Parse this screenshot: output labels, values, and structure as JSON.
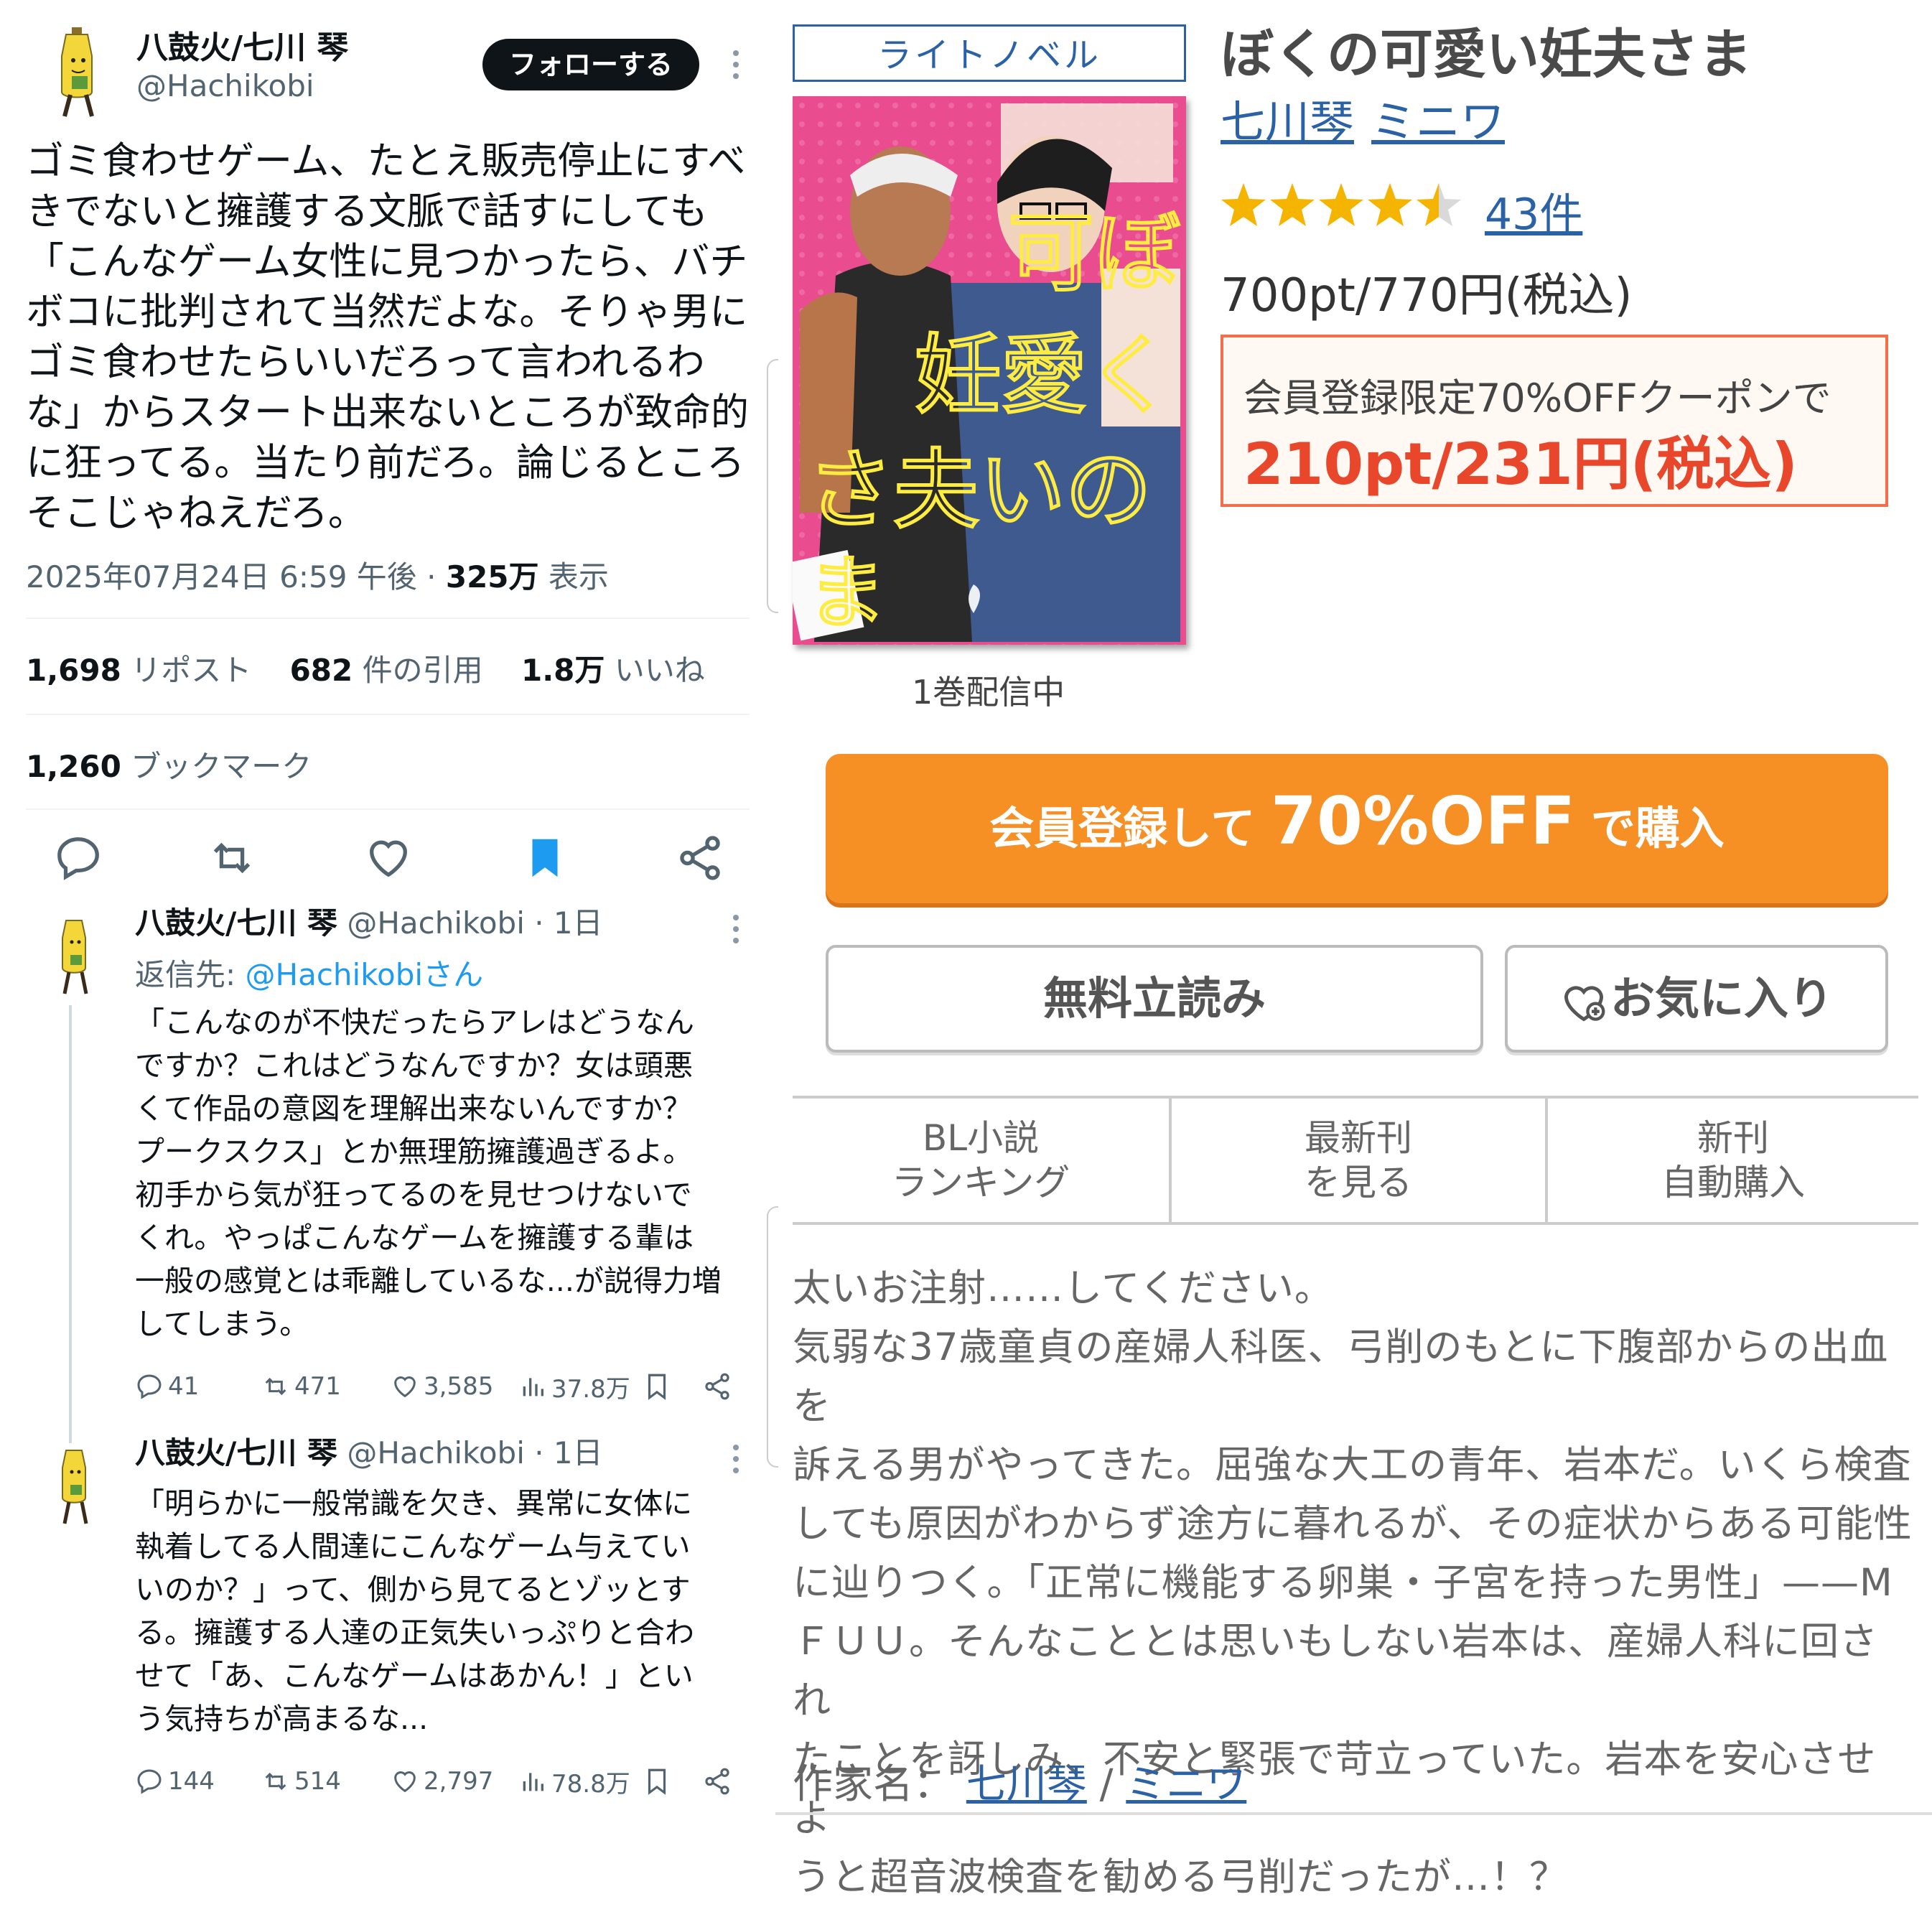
{
  "tweet": {
    "display_name": "八鼓火/七川 琴",
    "handle": "@Hachikobi",
    "follow_label": "フォローする",
    "text": "ゴミ食わせゲーム、たとえ販売停止にすべ\nきでないと擁護する文脈で話すにしても\n「こんなゲーム女性に見つかったら、バチ\nボコに批判されて当然だよな。そりゃ男に\nゴミ食わせたらいいだろって言われるわ\nな」からスタート出来ないところが致命的\nに狂ってる。当たり前だろ。論じるところ\nそこじゃねえだろ。",
    "timestamp": "2025年07月24日 6:59 午後 · ",
    "views_count": "325万",
    "views_label": " 表示",
    "reposts_count": "1,698",
    "reposts_label": " リポスト",
    "quotes_count": "682",
    "quotes_label": " 件の引用",
    "likes_count": "1.8万",
    "likes_label": " いいね",
    "bookmarks_count": "1,260",
    "bookmarks_label": " ブックマーク"
  },
  "replies": [
    {
      "display_name": "八鼓火/七川 琴",
      "handle_time": " @Hachikobi · 1日",
      "reply_to_prefix": "返信先: ",
      "reply_to_handle": "@Hachikobiさん",
      "text": "「こんなのが不快だったらアレはどうなん\nですか？これはどうなんですか？女は頭悪\nくて作品の意図を理解出来ないんですか？\nプークスクス」とか無理筋擁護過ぎるよ。\n初手から気が狂ってるのを見せつけないで\nくれ。やっぱこんなゲームを擁護する輩は\n一般の感覚とは乖離しているな...が説得力増\nしてしまう。",
      "replies": "41",
      "reposts": "471",
      "likes": "3,585",
      "views": "37.8万"
    },
    {
      "display_name": "八鼓火/七川 琴",
      "handle_time": " @Hachikobi · 1日",
      "text": "「明らかに一般常識を欠き、異常に女体に\n執着してる人間達にこんなゲーム与えてい\nいのか？」って、側から見てるとゾッとす\nる。擁護する人達の正気失いっぷりと合わ\nせて「あ、こんなゲームはあかん！」とい\nう気持ちが高まるな...",
      "replies": "144",
      "reposts": "514",
      "likes": "2,797",
      "views": "78.8万"
    }
  ],
  "store": {
    "genre_tag": "ライトノベル",
    "title": "ぼくの可愛い妊夫さま",
    "author1": "七川琴",
    "author2": "ミニワ",
    "rating": 4.5,
    "review_count": "43件",
    "price": "700pt/770円(税込)",
    "coupon_line1": "会員登録限定70%OFFクーポンで",
    "coupon_line2": "210pt/231円(税込)",
    "cover_title": "ぼくの可愛い妊夫さま",
    "volumes": "1巻配信中",
    "buy_small1": "会員登録して ",
    "buy_big": "70%OFF",
    "buy_small2": " で購入",
    "free_read_label": "無料立読み",
    "favorite_label": "お気に入り",
    "tabs": [
      {
        "line1": "BL小説",
        "line2": "ランキング"
      },
      {
        "line1": "最新刊",
        "line2": "を見る"
      },
      {
        "line1": "新刊",
        "line2": "自動購入"
      }
    ],
    "synopsis": "太いお注射……してください。\n気弱な37歳童貞の産婦人科医、弓削のもとに下腹部からの出血を\n訴える男がやってきた。屈強な大工の青年、岩本だ。いくら検査\nしても原因がわからず途方に暮れるが、その症状からある可能性\nに辿りつく。「正常に機能する卵巣・子宮を持った男性」——M\nＦＵＵ。そんなこととは思いもしない岩本は、産婦人科に回され\nたことを訝しみ、不安と緊張で苛立っていた。岩本を安心させよ\nうと超音波検査を勧める弓削だったが…！？",
    "author_label": "作家名：",
    "author_sep": " / "
  },
  "colors": {
    "link_blue": "#2b62a6",
    "x_blue": "#1d9bf0",
    "bookmark_blue": "#1d9bf0",
    "buy_orange": "#f68f24",
    "coupon_red": "#e8472b",
    "star_yellow": "#f5b400",
    "cover_pink": "#ea4d8f"
  }
}
